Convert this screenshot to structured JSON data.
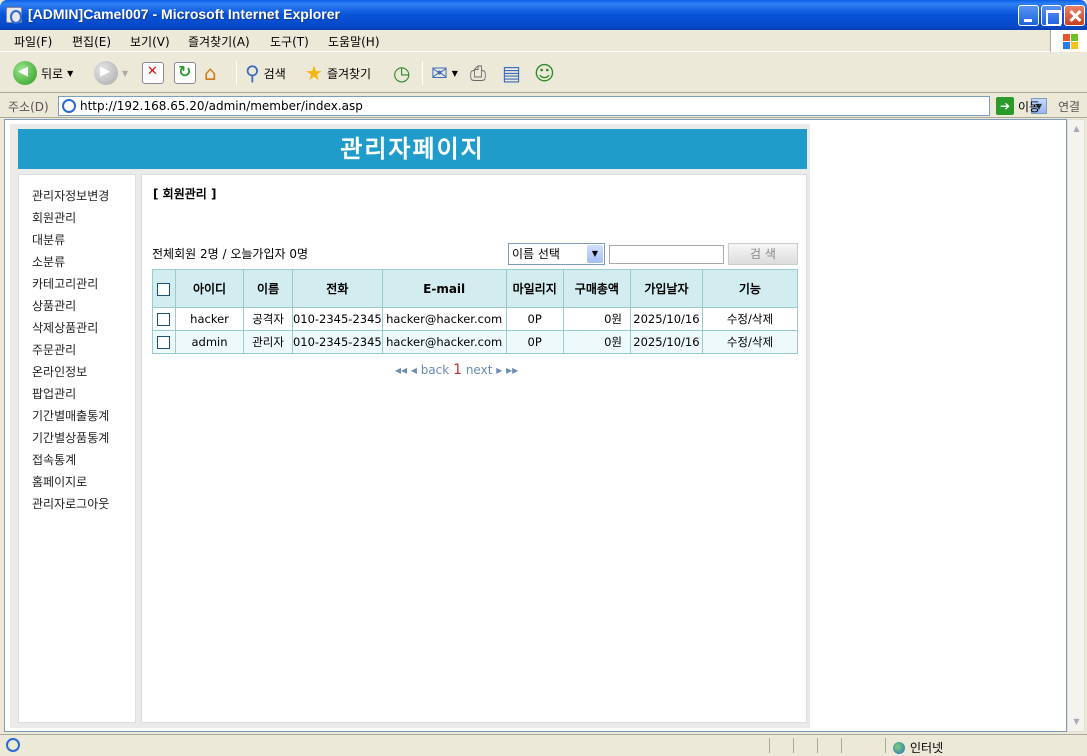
{
  "window": {
    "title": "[ADMIN]Camel007 - Microsoft Internet Explorer"
  },
  "menu": [
    "파일(F)",
    "편집(E)",
    "보기(V)",
    "즐겨찾기(A)",
    "도구(T)",
    "도움말(H)"
  ],
  "toolbar": {
    "back_label": "뒤로",
    "search_label": "검색",
    "favorites_label": "즐겨찾기"
  },
  "address": {
    "label": "주소(D)",
    "url": "http://192.168.65.20/admin/member/index.asp",
    "go_label": "이동",
    "links_label": "연결"
  },
  "page": {
    "banner": "관리자페이지",
    "sidebar": [
      "관리자정보변경",
      "회원관리",
      "대분류",
      "소분류",
      "카테고리관리",
      "상품관리",
      "삭제상품관리",
      "주문관리",
      "온라인정보",
      "팝업관리",
      "기간별매출통계",
      "기간별상품통계",
      "접속통계",
      "홈페이지로",
      "관리자로그아웃"
    ],
    "section_title": "[ 회원관리 ]",
    "summary": "전체회원 2명 / 오늘가입자 0명",
    "search": {
      "select_value": "이름 선택",
      "input_value": "",
      "button_label": "검 색"
    },
    "table": {
      "headers": [
        "아이디",
        "이름",
        "전화",
        "E-mail",
        "마일리지",
        "구매총액",
        "가입날자",
        "기능"
      ],
      "rows": [
        [
          "hacker",
          "공격자",
          "010-2345-2345",
          "hacker@hacker.com",
          "0P",
          "0원",
          "2025/10/16",
          "수정/삭제"
        ],
        [
          "admin",
          "관리자",
          "010-2345-2345",
          "hacker@hacker.com",
          "0P",
          "0원",
          "2025/10/16",
          "수정/삭제"
        ]
      ]
    },
    "pager": {
      "first": "◂◂",
      "back": "◂ back",
      "current": "1",
      "next": "next ▸",
      "last": "▸▸"
    }
  },
  "status": {
    "zone": "인터넷"
  }
}
